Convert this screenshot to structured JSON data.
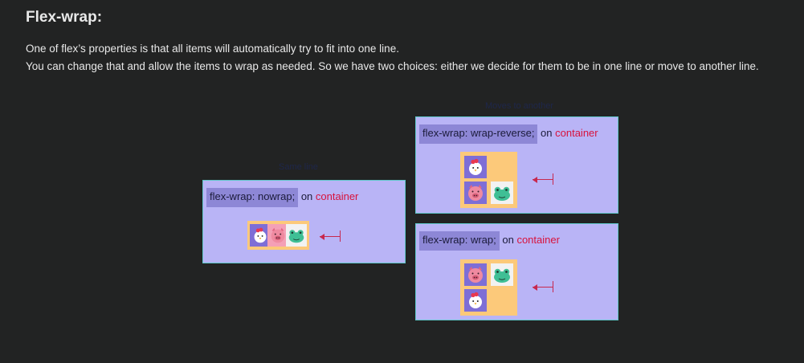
{
  "heading": "Flex-wrap:",
  "paragraph": {
    "line1": "One of flex’s properties is that all items will automatically try to fit into one line.",
    "line2": "You can change that and allow the items to wrap as needed. So we have two choices: either we decide for them to be in one line or move to another line."
  },
  "panels": {
    "nowrap": {
      "faint_label": "Same line",
      "code": "flex-wrap: nowrap;",
      "on": " on ",
      "target": "container"
    },
    "wrap_reverse": {
      "faint_label": "Moves to another",
      "code": "flex-wrap: wrap-reverse;",
      "on": " on ",
      "target": "container"
    },
    "wrap": {
      "code": "flex-wrap: wrap;",
      "on": " on ",
      "target": "container"
    }
  },
  "icons": [
    "chicken-icon",
    "pig-icon",
    "frog-icon",
    "arrow-left-icon"
  ],
  "colors": {
    "background": "#222323",
    "panel": "#b9b4f6",
    "panel_border": "#5fc7c9",
    "code_highlight": "#8d87d6",
    "keyword": "#d8123c",
    "demo_container": "#fcc97a",
    "tile_purple": "#7e6ed6",
    "tile_pink": "#f4a0b6",
    "frog_green": "#3fbf95"
  }
}
